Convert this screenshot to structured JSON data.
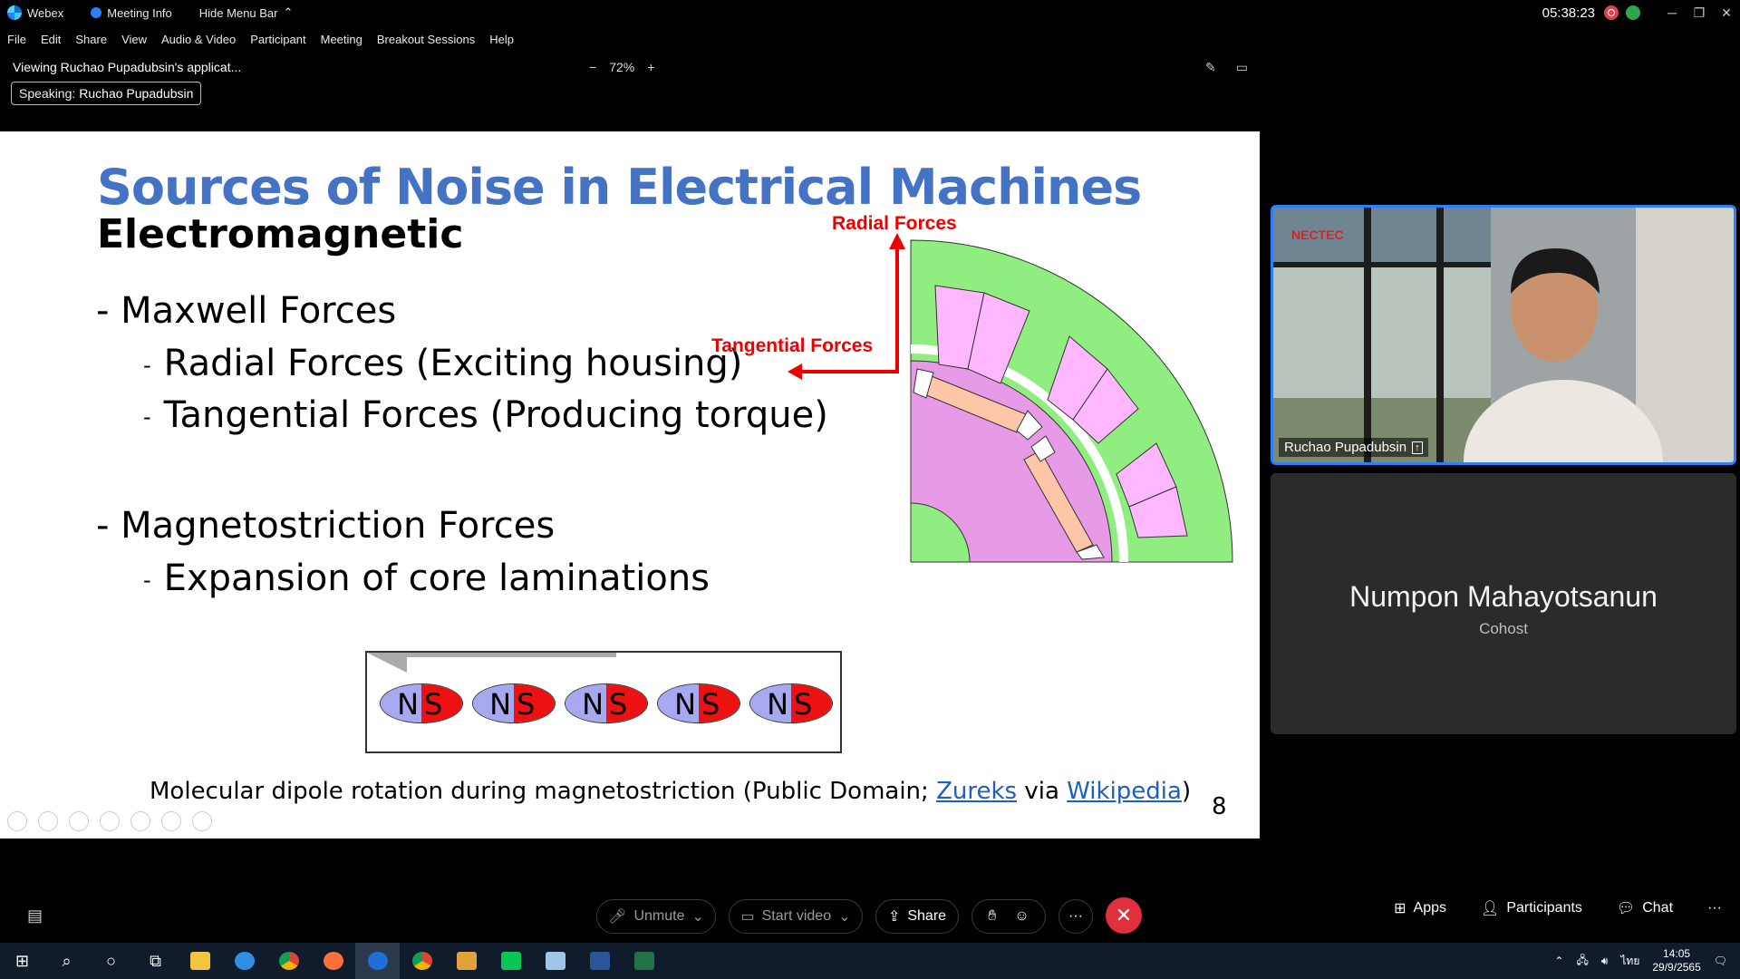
{
  "titlebar": {
    "app_name": "Webex",
    "meeting_info": "Meeting Info",
    "hide_menu": "Hide Menu Bar",
    "time": "05:38:23"
  },
  "menu": [
    "File",
    "Edit",
    "Share",
    "View",
    "Audio & Video",
    "Participant",
    "Meeting",
    "Breakout Sessions",
    "Help"
  ],
  "viewbar": {
    "viewing": "Viewing Ruchao Pupadubsin's applicat...",
    "zoom_minus": "−",
    "zoom": "72%",
    "zoom_plus": "+"
  },
  "speaking": {
    "label": "Speaking:",
    "name": "Ruchao Pupadubsin"
  },
  "slide": {
    "title": "Sources of Noise in Electrical Machines",
    "subtitle": "Electromagnetic",
    "bullet1": "- Maxwell Forces",
    "sub1": "Radial Forces (Exciting housing)",
    "sub2": "Tangential Forces (Producing torque)",
    "bullet2": "- Magnetostriction Forces",
    "sub3": "Expansion of core laminations",
    "dash": "-",
    "label_radial": "Radial Forces",
    "label_tangential": "Tangential Forces",
    "magnet_n": "N",
    "magnet_s": "S",
    "caption_pre": "Molecular dipole rotation during magnetostriction (Public Domain; ",
    "caption_link1": "Zureks",
    "caption_mid": " via ",
    "caption_link2": "Wikipedia",
    "caption_post": ")",
    "page": "8"
  },
  "participants": {
    "video_name": "Ruchao Pupadubsin",
    "cohost_name": "Numpon Mahayotsanun",
    "cohost_role": "Cohost"
  },
  "controls": {
    "unmute": "Unmute",
    "start_video": "Start video",
    "share": "Share",
    "more": "···",
    "apps": "Apps",
    "participants": "Participants",
    "chat": "Chat",
    "overflow": "···"
  },
  "taskbar": {
    "lang": "ไทย",
    "time": "14:05",
    "date": "29/9/2565"
  },
  "colors": {
    "accent": "#2d7ff9",
    "end_call": "#e0303c",
    "slide_title": "#4472c4",
    "force_label": "#e00000",
    "stator": "#90ee80",
    "rotor": "#e79ae6"
  }
}
